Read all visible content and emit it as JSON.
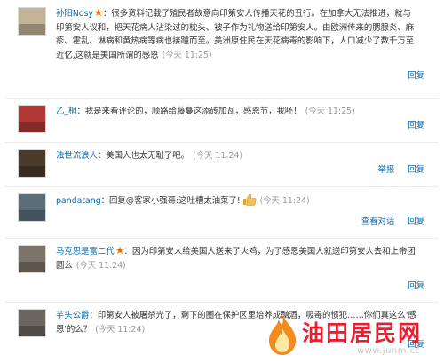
{
  "comments": [
    {
      "user": "孙阳Nosy",
      "verified": true,
      "text": "：很多资料记载了殖民者故意向印第安人传播天花的丑行。在加拿大无法推进，就与印第安人议和，把天花病人沾染过的枕头、被子作为礼物送给印第安人。由欧洲传来的腮腺炎、麻疹、霍乱、淋病和黄热病等病也接踵而至。美洲原住民在天花病毒的影响下，人口减少了数千万至近亿,这就是美国所谓的感恩",
      "time": "(今天 11:25)",
      "actions": [
        "回复"
      ]
    },
    {
      "user": "乙_桐",
      "verified": false,
      "text": "：我是来看评论的，顺路给藤蔓这添砖加瓦，感恩节，我呸！",
      "time": "(今天 11:25)",
      "actions": [
        "回复"
      ]
    },
    {
      "user": "浊世流浪人",
      "verified": false,
      "text": "：美国人也太无耻了吧。",
      "time": "(今天 11:24)",
      "actions": [
        "举报",
        "回复"
      ]
    },
    {
      "user": "pandatang",
      "verified": false,
      "text": "：回复@客家小强哥:这吐槽太油菜了!",
      "time": "(今天 11:24)",
      "actions": [
        "查看对话",
        "回复"
      ]
    },
    {
      "user": "马克思是富二代",
      "verified": true,
      "text": "：因为印第安人给美国人送来了火鸡，为了感恩美国人就送印第安人去和上帝团圆么",
      "time": "(今天 11:24)",
      "actions": [
        "回复"
      ]
    },
    {
      "user": "芋头公爵",
      "verified": false,
      "text": "：印第安人被屠杀光了，剩下的圈在保护区里培养成酗酒，吸毒的惯犯……你们真这么'感恩'的么？",
      "time": "(今天 11:24)",
      "actions": [
        "回复"
      ]
    }
  ],
  "watermark": {
    "logo_text": "油田居民网",
    "url": "www.junm.cc"
  },
  "colors": {
    "link": "#0a68a8",
    "time": "#999999",
    "watermark": "#ee1c2e",
    "flame": "#f28c1e"
  }
}
